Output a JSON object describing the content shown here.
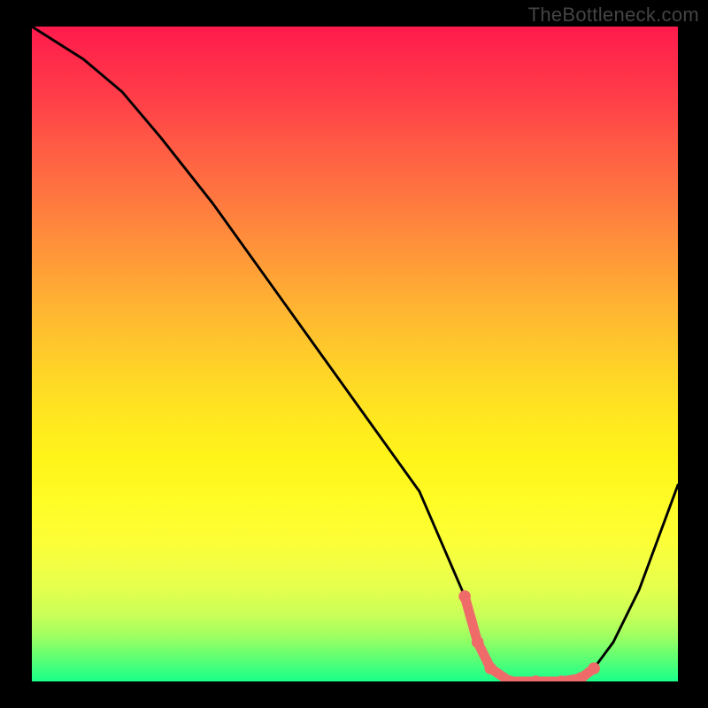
{
  "watermark": "TheBottleneck.com",
  "chart_data": {
    "type": "line",
    "title": "",
    "xlabel": "",
    "ylabel": "",
    "xlim": [
      0,
      100
    ],
    "ylim": [
      0,
      100
    ],
    "series": [
      {
        "name": "main-curve",
        "color": "#000000",
        "x": [
          0,
          8,
          14,
          20,
          28,
          36,
          44,
          52,
          60,
          67,
          69,
          71,
          74,
          78,
          82,
          85,
          87,
          90,
          94,
          100
        ],
        "values": [
          100,
          95,
          90,
          83,
          73,
          62,
          51,
          40,
          29,
          13,
          6,
          2,
          0,
          0,
          0,
          0.5,
          2,
          6,
          14,
          30
        ]
      },
      {
        "name": "highlight-segment",
        "color": "#ef6b6a",
        "x": [
          67,
          69,
          71,
          74,
          78,
          82,
          85,
          87
        ],
        "values": [
          13,
          6,
          2,
          0,
          0,
          0,
          0.5,
          2
        ]
      }
    ],
    "gradient_stops": [
      {
        "pos": 0,
        "color": "#ff1a4d"
      },
      {
        "pos": 50,
        "color": "#ffc52d"
      },
      {
        "pos": 80,
        "color": "#fdff35"
      },
      {
        "pos": 100,
        "color": "#19ff8a"
      }
    ]
  }
}
